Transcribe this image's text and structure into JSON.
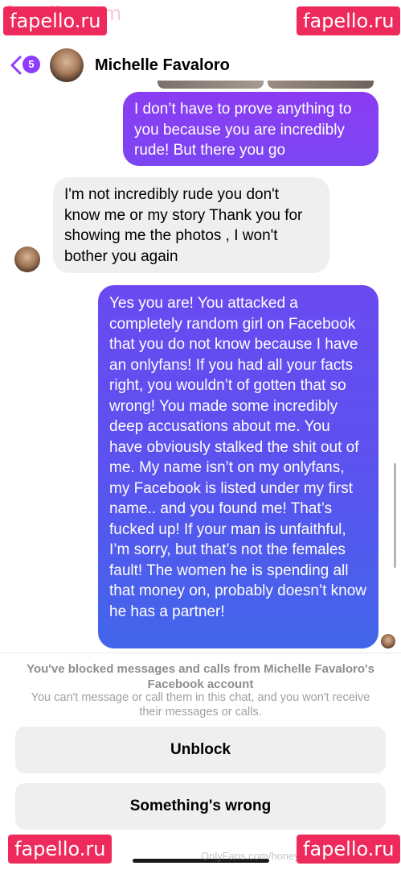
{
  "header": {
    "back_count": "5",
    "contact_name": "Michelle Favaloro"
  },
  "messages": [
    {
      "direction": "outgoing",
      "text": "I don’t have to prove anything to you because you are incredibly rude! But there you go"
    },
    {
      "direction": "incoming",
      "text": "I'm not incredibly rude you don't know me or my story Thank you for showing me the photos , I won't bother you again"
    },
    {
      "direction": "outgoing",
      "text": "Yes you are! You attacked a completely random girl on Facebook that you do not know because I have an onlyfans! If you had all your facts right, you wouldn’t of gotten that so wrong! You made some incredibly deep accusations about me. You have obviously stalked the shit out of me. My name isn’t on my onlyfans, my Facebook is listed under my first name.. and you found me! That’s fucked up! If your man is unfaithful, I’m sorry, but that’s not the females fault! The women he is spending all that money on, probably doesn’t know he has a partner!"
    }
  ],
  "blocked_notice": {
    "title": "You've blocked messages and calls from Michelle Favaloro's Facebook account",
    "description": "You can't message or call them in this chat, and you won't receive their messages or calls."
  },
  "actions": {
    "unblock_label": "Unblock",
    "something_wrong_label": "Something's wrong"
  },
  "watermarks": {
    "site": "fapello.ru",
    "ghost": "fapello.com",
    "footer": "OnlyFans.com/honey-xo-freeonlyfans"
  },
  "colors": {
    "accent": "#8e3dff",
    "outgoing_top": "#8b3cf2",
    "outgoing_bottom": "#4266ea",
    "incoming_bubble": "#efefef",
    "watermark": "#ee2a5c"
  },
  "icons": [
    "back-chevron-icon",
    "avatar"
  ]
}
